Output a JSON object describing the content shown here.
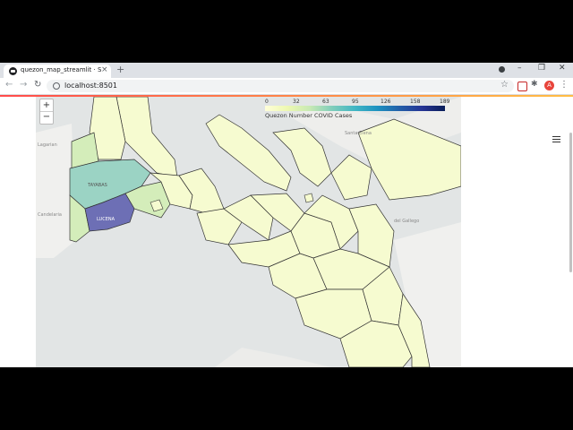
{
  "browser": {
    "tab_title": "quezon_map_streamlit · Streamlit",
    "tab_close": "×",
    "new_tab": "+",
    "url": "localhost:8501",
    "window_buttons": [
      "–",
      "❐",
      "✕"
    ],
    "nav_icons": [
      "back-arrow-icon",
      "forward-arrow-icon",
      "reload-icon"
    ],
    "profile_initial": "A"
  },
  "map": {
    "zoom_in": "+",
    "zoom_out": "−",
    "legend": {
      "ticks": [
        "0",
        "32",
        "63",
        "95",
        "126",
        "158",
        "189"
      ],
      "title": "Quezon Number COVID Cases",
      "scale_colors": [
        "#ffffd9",
        "#edf8b1",
        "#c7e9b4",
        "#7fcdbb",
        "#41b6c4",
        "#1d91c0",
        "#225ea8",
        "#253494",
        "#081d58"
      ]
    },
    "place_labels": {
      "tayabas": "TAYABAS",
      "lucena": "LUCENA",
      "santa_elena": "Santa Elena",
      "del_gallego": "del Gallego",
      "candelaria": "Candelaria"
    },
    "colors": {
      "low": "#f6fbd0",
      "lucena": "#6d6fb5",
      "tayabas": "#9bd3c4",
      "mid": "#d4edba",
      "water": "#e2e5e5",
      "land": "#f2f2f0"
    }
  },
  "app": {
    "menu_icon": "hamburger-menu-icon"
  }
}
